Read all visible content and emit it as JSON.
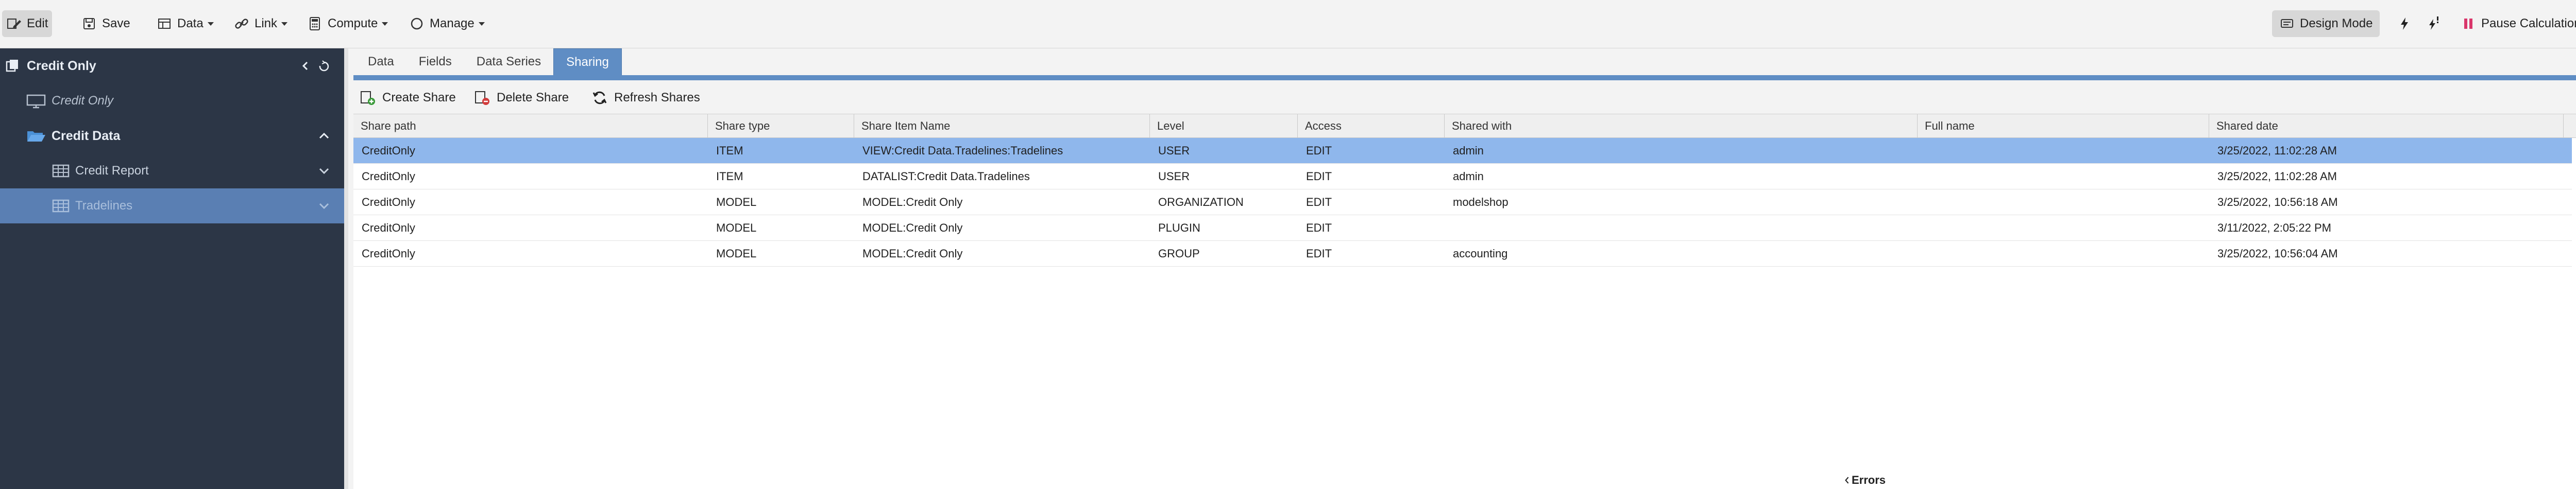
{
  "toolbar": {
    "edit": "Edit",
    "save": "Save",
    "data": "Data",
    "link": "Link",
    "compute": "Compute",
    "manage": "Manage",
    "design_mode": "Design Mode",
    "pause": "Pause Calculations"
  },
  "sidebar": {
    "title": "Credit Only",
    "items": [
      {
        "label": "Credit Only",
        "icon": "monitor-icon"
      },
      {
        "label": "Credit Data",
        "icon": "folder-open-icon"
      },
      {
        "label": "Credit Report",
        "icon": "table-icon"
      },
      {
        "label": "Tradelines",
        "icon": "table-icon"
      }
    ]
  },
  "tabs": [
    "Data",
    "Fields",
    "Data Series",
    "Sharing"
  ],
  "active_tab": "Sharing",
  "actions": {
    "create": "Create Share",
    "delete": "Delete Share",
    "refresh": "Refresh Shares"
  },
  "table": {
    "columns": [
      "Share path",
      "Share type",
      "Share Item Name",
      "Level",
      "Access",
      "Shared with",
      "Full name",
      "Shared date"
    ],
    "rows": [
      [
        "CreditOnly",
        "ITEM",
        "VIEW:Credit Data.Tradelines:Tradelines",
        "USER",
        "EDIT",
        "admin",
        "",
        "3/25/2022, 11:02:28 AM"
      ],
      [
        "CreditOnly",
        "ITEM",
        "DATALIST:Credit Data.Tradelines",
        "USER",
        "EDIT",
        "admin",
        "",
        "3/25/2022, 11:02:28 AM"
      ],
      [
        "CreditOnly",
        "MODEL",
        "MODEL:Credit Only",
        "ORGANIZATION",
        "EDIT",
        "modelshop",
        "",
        "3/25/2022, 10:56:18 AM"
      ],
      [
        "CreditOnly",
        "MODEL",
        "MODEL:Credit Only",
        "PLUGIN",
        "EDIT",
        "",
        "",
        "3/11/2022, 2:05:22 PM"
      ],
      [
        "CreditOnly",
        "MODEL",
        "MODEL:Credit Only",
        "GROUP",
        "EDIT",
        "accounting",
        "",
        "3/25/2022, 10:56:04 AM"
      ]
    ]
  },
  "footer": {
    "errors": "Errors"
  },
  "colors": {
    "sidebar_bg": "#2c3646",
    "accent": "#5f8dc4",
    "selected_row": "#8fb7ec",
    "pause_icon": "#d9366b"
  }
}
